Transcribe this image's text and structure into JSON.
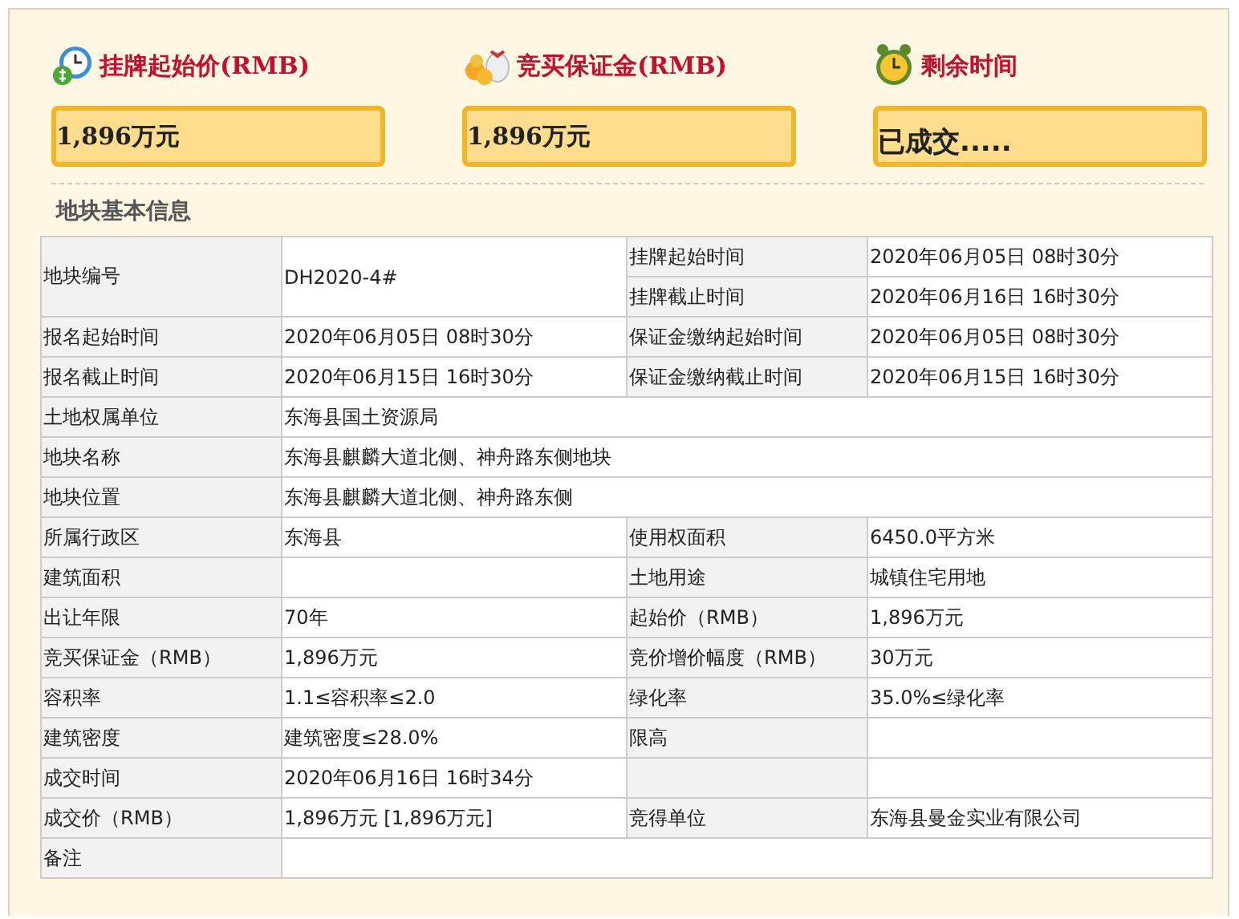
{
  "summary": [
    {
      "kind": "clock",
      "title": "挂牌起始价(RMB)",
      "value": "1,896万元"
    },
    {
      "kind": "coins",
      "title": "竞买保证金(RMB)",
      "value": "1,896万元"
    },
    {
      "kind": "alarm",
      "title": "剩余时间",
      "value": "已成交....."
    }
  ],
  "section_title": "地块基本信息",
  "table": {
    "rows": [
      {
        "kind": "grouped",
        "label": "地块编号",
        "value": "DH2020-4#",
        "sub": [
          {
            "label": "挂牌起始时间",
            "value": "2020年06月05日 08时30分"
          },
          {
            "label": "挂牌截止时间",
            "value": "2020年06月16日 16时30分"
          }
        ]
      },
      {
        "kind": "split",
        "label": "报名起始时间",
        "value": "2020年06月05日 08时30分",
        "label_2": "保证金缴纳起始时间",
        "value_2": "2020年06月05日 08时30分"
      },
      {
        "kind": "split",
        "label": "报名截止时间",
        "value": "2020年06月15日 16时30分",
        "label_2": "保证金缴纳截止时间",
        "value_2": "2020年06月15日 16时30分"
      },
      {
        "kind": "full",
        "label": "土地权属单位",
        "value": "东海县国土资源局"
      },
      {
        "kind": "full",
        "label": "地块名称",
        "value": "东海县麒麟大道北侧、神舟路东侧地块"
      },
      {
        "kind": "full",
        "label": "地块位置",
        "value": "东海县麒麟大道北侧、神舟路东侧"
      },
      {
        "kind": "split",
        "label": "所属行政区",
        "value": "东海县",
        "label_2": "使用权面积",
        "value_2": "6450.0平方米"
      },
      {
        "kind": "split",
        "label": "建筑面积",
        "label_2": "土地用途",
        "value_2": "城镇住宅用地"
      },
      {
        "kind": "split",
        "label": "出让年限",
        "value": "70年",
        "label_2": "起始价（RMB）",
        "value_2": "1,896万元"
      },
      {
        "kind": "split",
        "label": "竞买保证金（RMB）",
        "value": "1,896万元",
        "label_2": "竞价增价幅度（RMB）",
        "value_2": "30万元"
      },
      {
        "kind": "split",
        "label": "容积率",
        "value": "1.1≤容积率≤2.0",
        "label_2": "绿化率",
        "value_2": "35.0%≤绿化率"
      },
      {
        "kind": "split",
        "label": "建筑密度",
        "value": "建筑密度≤28.0%",
        "label_2": "限高"
      },
      {
        "kind": "split",
        "label": "成交时间",
        "value": "2020年06月16日 16时34分"
      },
      {
        "kind": "split",
        "label": "成交价（RMB）",
        "value": "1,896万元 [1,896万元]",
        "label_2": "竞得单位",
        "value_2": "东海县曼金实业有限公司"
      },
      {
        "kind": "full",
        "label": "备注"
      }
    ]
  }
}
